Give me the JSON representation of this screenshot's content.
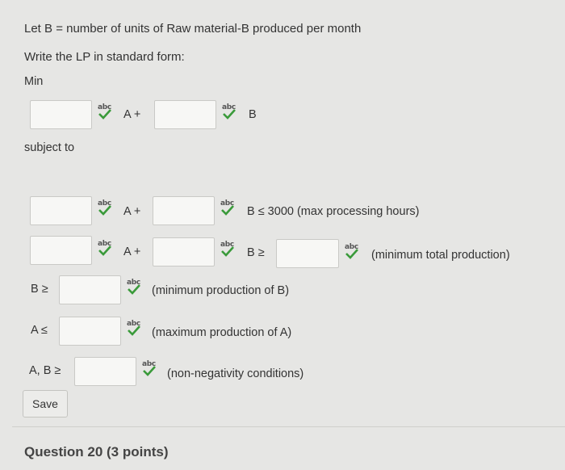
{
  "intro": {
    "let_text": "Let B = number of units of Raw material-B produced per month",
    "write_text": "Write the LP in standard form:",
    "min_label": "Min"
  },
  "objective": {
    "a_label": "A +",
    "b_label": "B"
  },
  "subject_to": "subject to",
  "constraints": {
    "c1_a_label": "A +",
    "c1_b_label": "B ≤ 3000 (max processing hours)",
    "c2_a_label": "A +",
    "c2_b_label": "B ≥",
    "c2_note": "(minimum total production)",
    "c3_prefix": "B ≥",
    "c3_note": "(minimum production of B)",
    "c4_prefix": "A ≤",
    "c4_note": "(maximum production of A)",
    "c5_prefix": "A, B ≥",
    "c5_note": "(non-negativity conditions)"
  },
  "spellcheck": {
    "icon": "spellcheck-icon",
    "text": "abc",
    "check_color": "#3a9a3a"
  },
  "save_label": "Save",
  "next_question": "Question 20 (3 points)"
}
